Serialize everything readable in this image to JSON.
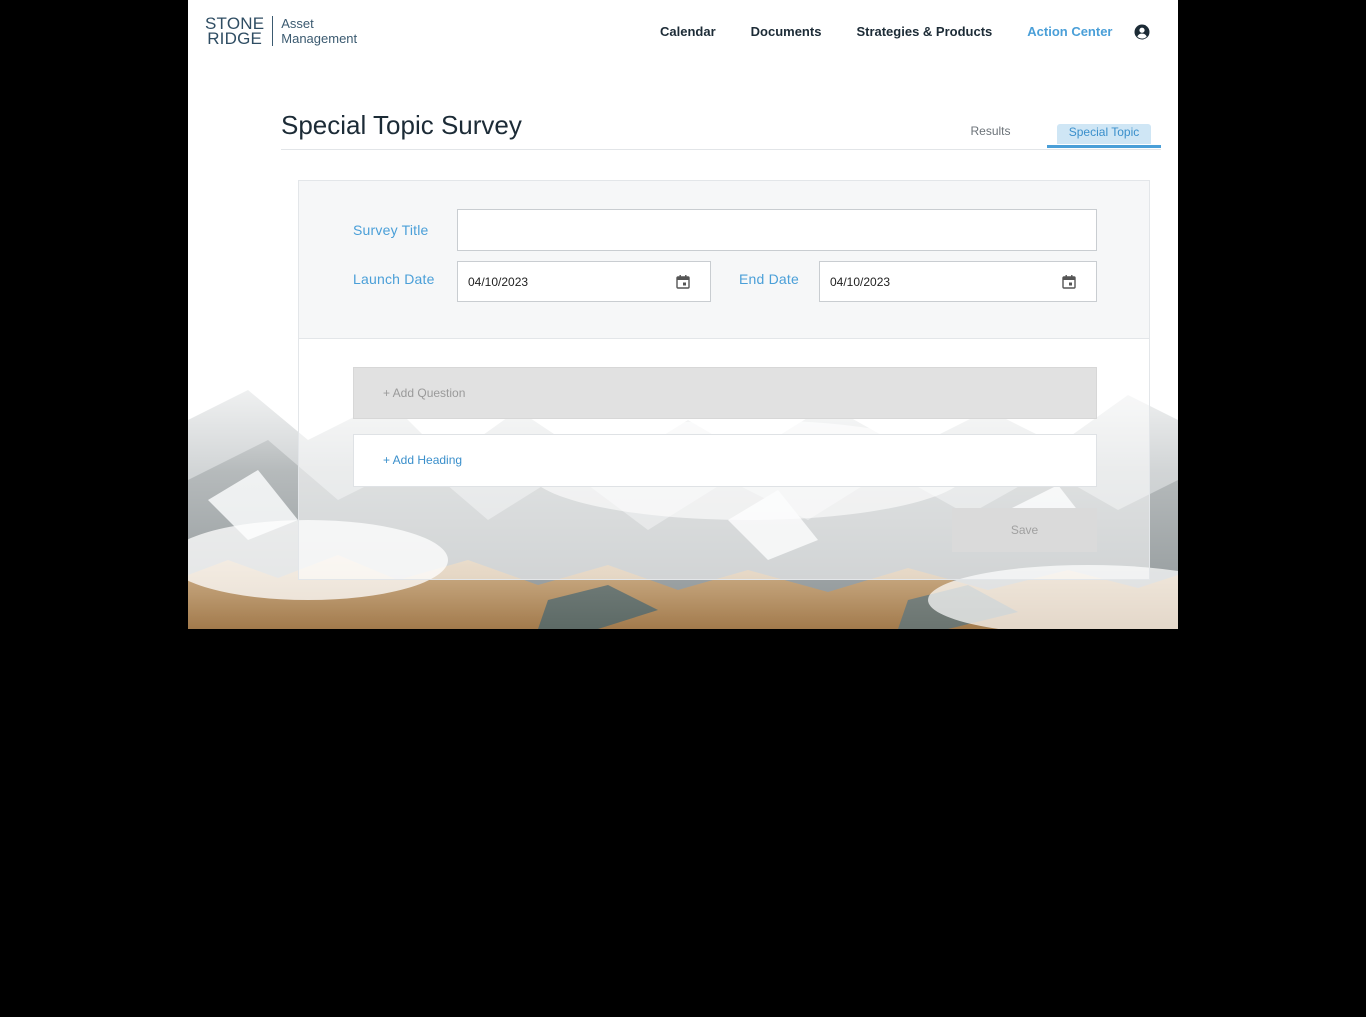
{
  "header": {
    "logo": {
      "line1": "STONE",
      "line2": "RIDGE",
      "sub1": "Asset",
      "sub2": "Management"
    },
    "nav": [
      {
        "label": "Calendar",
        "active": false
      },
      {
        "label": "Documents",
        "active": false
      },
      {
        "label": "Strategies & Products",
        "active": false
      },
      {
        "label": "Action Center",
        "active": true
      }
    ],
    "user_icon": "user-circle-icon"
  },
  "page": {
    "title": "Special Topic Survey",
    "tabs": [
      {
        "label": "Results",
        "selected": false
      },
      {
        "label": "Special Topic",
        "selected": true
      }
    ]
  },
  "form": {
    "survey_title_label": "Survey Title",
    "survey_title_value": "",
    "launch_date_label": "Launch Date",
    "launch_date_value": "04/10/2023",
    "end_date_label": "End Date",
    "end_date_value": "04/10/2023",
    "calendar_icon": "calendar-icon",
    "add_question_label": "+ Add Question",
    "add_heading_label": "+ Add Heading",
    "save_label": "Save"
  },
  "colors": {
    "accent": "#4a9fd8",
    "text_dark": "#1c2b36",
    "page_bg": "#000000"
  }
}
